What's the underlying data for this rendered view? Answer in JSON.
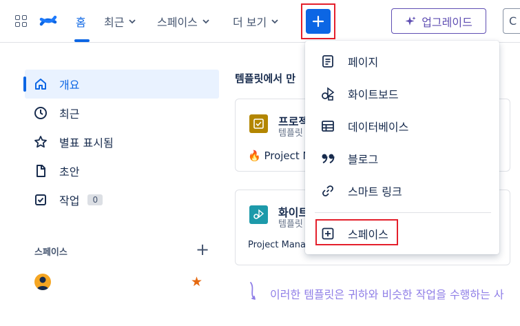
{
  "topbar": {
    "apps_icon": "app-grid-icon",
    "logo": "confluence-logo",
    "nav": [
      {
        "label": "홈",
        "active": true,
        "dropdown": false
      },
      {
        "label": "최근",
        "active": false,
        "dropdown": true
      },
      {
        "label": "스페이스",
        "active": false,
        "dropdown": true
      },
      {
        "label": "더 보기",
        "active": false,
        "dropdown": true
      }
    ],
    "create_icon": "plus-icon",
    "upgrade_label": "업그레이드",
    "search_icon": "search-icon"
  },
  "sidebar": {
    "items": [
      {
        "label": "개요",
        "icon": "home-icon",
        "active": true
      },
      {
        "label": "최근",
        "icon": "clock-icon",
        "active": false
      },
      {
        "label": "별표 표시됨",
        "icon": "star-icon",
        "active": false
      },
      {
        "label": "초안",
        "icon": "draft-icon",
        "active": false
      },
      {
        "label": "작업",
        "icon": "task-icon",
        "active": false,
        "badge": "0"
      }
    ],
    "spaces_header": "스페이스"
  },
  "main": {
    "section_title": "템플릿에서 만",
    "cards": [
      {
        "title": "프로젝트",
        "subtitle": "템플릿",
        "footer": "🔥 Project M",
        "icon_color": "#b38600"
      },
      {
        "title": "화이트",
        "subtitle": "템플릿",
        "footer": "Project Manag",
        "icon_color": "#1d9aaa"
      }
    ],
    "hint": "이러한 템플릿은 귀하와 비슷한 작업을 수행하는 사"
  },
  "create_menu": {
    "items": [
      {
        "label": "페이지",
        "icon": "page-icon"
      },
      {
        "label": "화이트보드",
        "icon": "whiteboard-icon"
      },
      {
        "label": "데이터베이스",
        "icon": "database-icon"
      },
      {
        "label": "블로그",
        "icon": "quote-icon"
      },
      {
        "label": "스마트 링크",
        "icon": "link-icon"
      },
      {
        "label": "스페이스",
        "icon": "add-space-icon"
      }
    ]
  },
  "colors": {
    "accent": "#0c66e4",
    "upgrade": "#5e4db2",
    "highlight": "#e41e2a"
  }
}
